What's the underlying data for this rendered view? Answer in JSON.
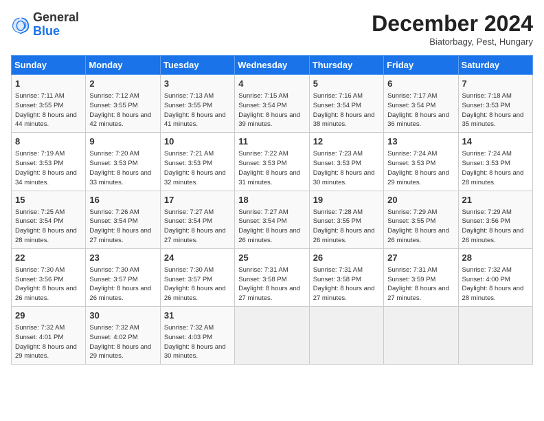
{
  "header": {
    "logo_line1": "General",
    "logo_line2": "Blue",
    "title": "December 2024",
    "subtitle": "Biatorbagy, Pest, Hungary"
  },
  "calendar": {
    "days_of_week": [
      "Sunday",
      "Monday",
      "Tuesday",
      "Wednesday",
      "Thursday",
      "Friday",
      "Saturday"
    ],
    "weeks": [
      [
        {
          "day": "1",
          "sunrise": "Sunrise: 7:11 AM",
          "sunset": "Sunset: 3:55 PM",
          "daylight": "Daylight: 8 hours and 44 minutes."
        },
        {
          "day": "2",
          "sunrise": "Sunrise: 7:12 AM",
          "sunset": "Sunset: 3:55 PM",
          "daylight": "Daylight: 8 hours and 42 minutes."
        },
        {
          "day": "3",
          "sunrise": "Sunrise: 7:13 AM",
          "sunset": "Sunset: 3:55 PM",
          "daylight": "Daylight: 8 hours and 41 minutes."
        },
        {
          "day": "4",
          "sunrise": "Sunrise: 7:15 AM",
          "sunset": "Sunset: 3:54 PM",
          "daylight": "Daylight: 8 hours and 39 minutes."
        },
        {
          "day": "5",
          "sunrise": "Sunrise: 7:16 AM",
          "sunset": "Sunset: 3:54 PM",
          "daylight": "Daylight: 8 hours and 38 minutes."
        },
        {
          "day": "6",
          "sunrise": "Sunrise: 7:17 AM",
          "sunset": "Sunset: 3:54 PM",
          "daylight": "Daylight: 8 hours and 36 minutes."
        },
        {
          "day": "7",
          "sunrise": "Sunrise: 7:18 AM",
          "sunset": "Sunset: 3:53 PM",
          "daylight": "Daylight: 8 hours and 35 minutes."
        }
      ],
      [
        {
          "day": "8",
          "sunrise": "Sunrise: 7:19 AM",
          "sunset": "Sunset: 3:53 PM",
          "daylight": "Daylight: 8 hours and 34 minutes."
        },
        {
          "day": "9",
          "sunrise": "Sunrise: 7:20 AM",
          "sunset": "Sunset: 3:53 PM",
          "daylight": "Daylight: 8 hours and 33 minutes."
        },
        {
          "day": "10",
          "sunrise": "Sunrise: 7:21 AM",
          "sunset": "Sunset: 3:53 PM",
          "daylight": "Daylight: 8 hours and 32 minutes."
        },
        {
          "day": "11",
          "sunrise": "Sunrise: 7:22 AM",
          "sunset": "Sunset: 3:53 PM",
          "daylight": "Daylight: 8 hours and 31 minutes."
        },
        {
          "day": "12",
          "sunrise": "Sunrise: 7:23 AM",
          "sunset": "Sunset: 3:53 PM",
          "daylight": "Daylight: 8 hours and 30 minutes."
        },
        {
          "day": "13",
          "sunrise": "Sunrise: 7:24 AM",
          "sunset": "Sunset: 3:53 PM",
          "daylight": "Daylight: 8 hours and 29 minutes."
        },
        {
          "day": "14",
          "sunrise": "Sunrise: 7:24 AM",
          "sunset": "Sunset: 3:53 PM",
          "daylight": "Daylight: 8 hours and 28 minutes."
        }
      ],
      [
        {
          "day": "15",
          "sunrise": "Sunrise: 7:25 AM",
          "sunset": "Sunset: 3:54 PM",
          "daylight": "Daylight: 8 hours and 28 minutes."
        },
        {
          "day": "16",
          "sunrise": "Sunrise: 7:26 AM",
          "sunset": "Sunset: 3:54 PM",
          "daylight": "Daylight: 8 hours and 27 minutes."
        },
        {
          "day": "17",
          "sunrise": "Sunrise: 7:27 AM",
          "sunset": "Sunset: 3:54 PM",
          "daylight": "Daylight: 8 hours and 27 minutes."
        },
        {
          "day": "18",
          "sunrise": "Sunrise: 7:27 AM",
          "sunset": "Sunset: 3:54 PM",
          "daylight": "Daylight: 8 hours and 26 minutes."
        },
        {
          "day": "19",
          "sunrise": "Sunrise: 7:28 AM",
          "sunset": "Sunset: 3:55 PM",
          "daylight": "Daylight: 8 hours and 26 minutes."
        },
        {
          "day": "20",
          "sunrise": "Sunrise: 7:29 AM",
          "sunset": "Sunset: 3:55 PM",
          "daylight": "Daylight: 8 hours and 26 minutes."
        },
        {
          "day": "21",
          "sunrise": "Sunrise: 7:29 AM",
          "sunset": "Sunset: 3:56 PM",
          "daylight": "Daylight: 8 hours and 26 minutes."
        }
      ],
      [
        {
          "day": "22",
          "sunrise": "Sunrise: 7:30 AM",
          "sunset": "Sunset: 3:56 PM",
          "daylight": "Daylight: 8 hours and 26 minutes."
        },
        {
          "day": "23",
          "sunrise": "Sunrise: 7:30 AM",
          "sunset": "Sunset: 3:57 PM",
          "daylight": "Daylight: 8 hours and 26 minutes."
        },
        {
          "day": "24",
          "sunrise": "Sunrise: 7:30 AM",
          "sunset": "Sunset: 3:57 PM",
          "daylight": "Daylight: 8 hours and 26 minutes."
        },
        {
          "day": "25",
          "sunrise": "Sunrise: 7:31 AM",
          "sunset": "Sunset: 3:58 PM",
          "daylight": "Daylight: 8 hours and 27 minutes."
        },
        {
          "day": "26",
          "sunrise": "Sunrise: 7:31 AM",
          "sunset": "Sunset: 3:58 PM",
          "daylight": "Daylight: 8 hours and 27 minutes."
        },
        {
          "day": "27",
          "sunrise": "Sunrise: 7:31 AM",
          "sunset": "Sunset: 3:59 PM",
          "daylight": "Daylight: 8 hours and 27 minutes."
        },
        {
          "day": "28",
          "sunrise": "Sunrise: 7:32 AM",
          "sunset": "Sunset: 4:00 PM",
          "daylight": "Daylight: 8 hours and 28 minutes."
        }
      ],
      [
        {
          "day": "29",
          "sunrise": "Sunrise: 7:32 AM",
          "sunset": "Sunset: 4:01 PM",
          "daylight": "Daylight: 8 hours and 29 minutes."
        },
        {
          "day": "30",
          "sunrise": "Sunrise: 7:32 AM",
          "sunset": "Sunset: 4:02 PM",
          "daylight": "Daylight: 8 hours and 29 minutes."
        },
        {
          "day": "31",
          "sunrise": "Sunrise: 7:32 AM",
          "sunset": "Sunset: 4:03 PM",
          "daylight": "Daylight: 8 hours and 30 minutes."
        },
        null,
        null,
        null,
        null
      ]
    ]
  }
}
